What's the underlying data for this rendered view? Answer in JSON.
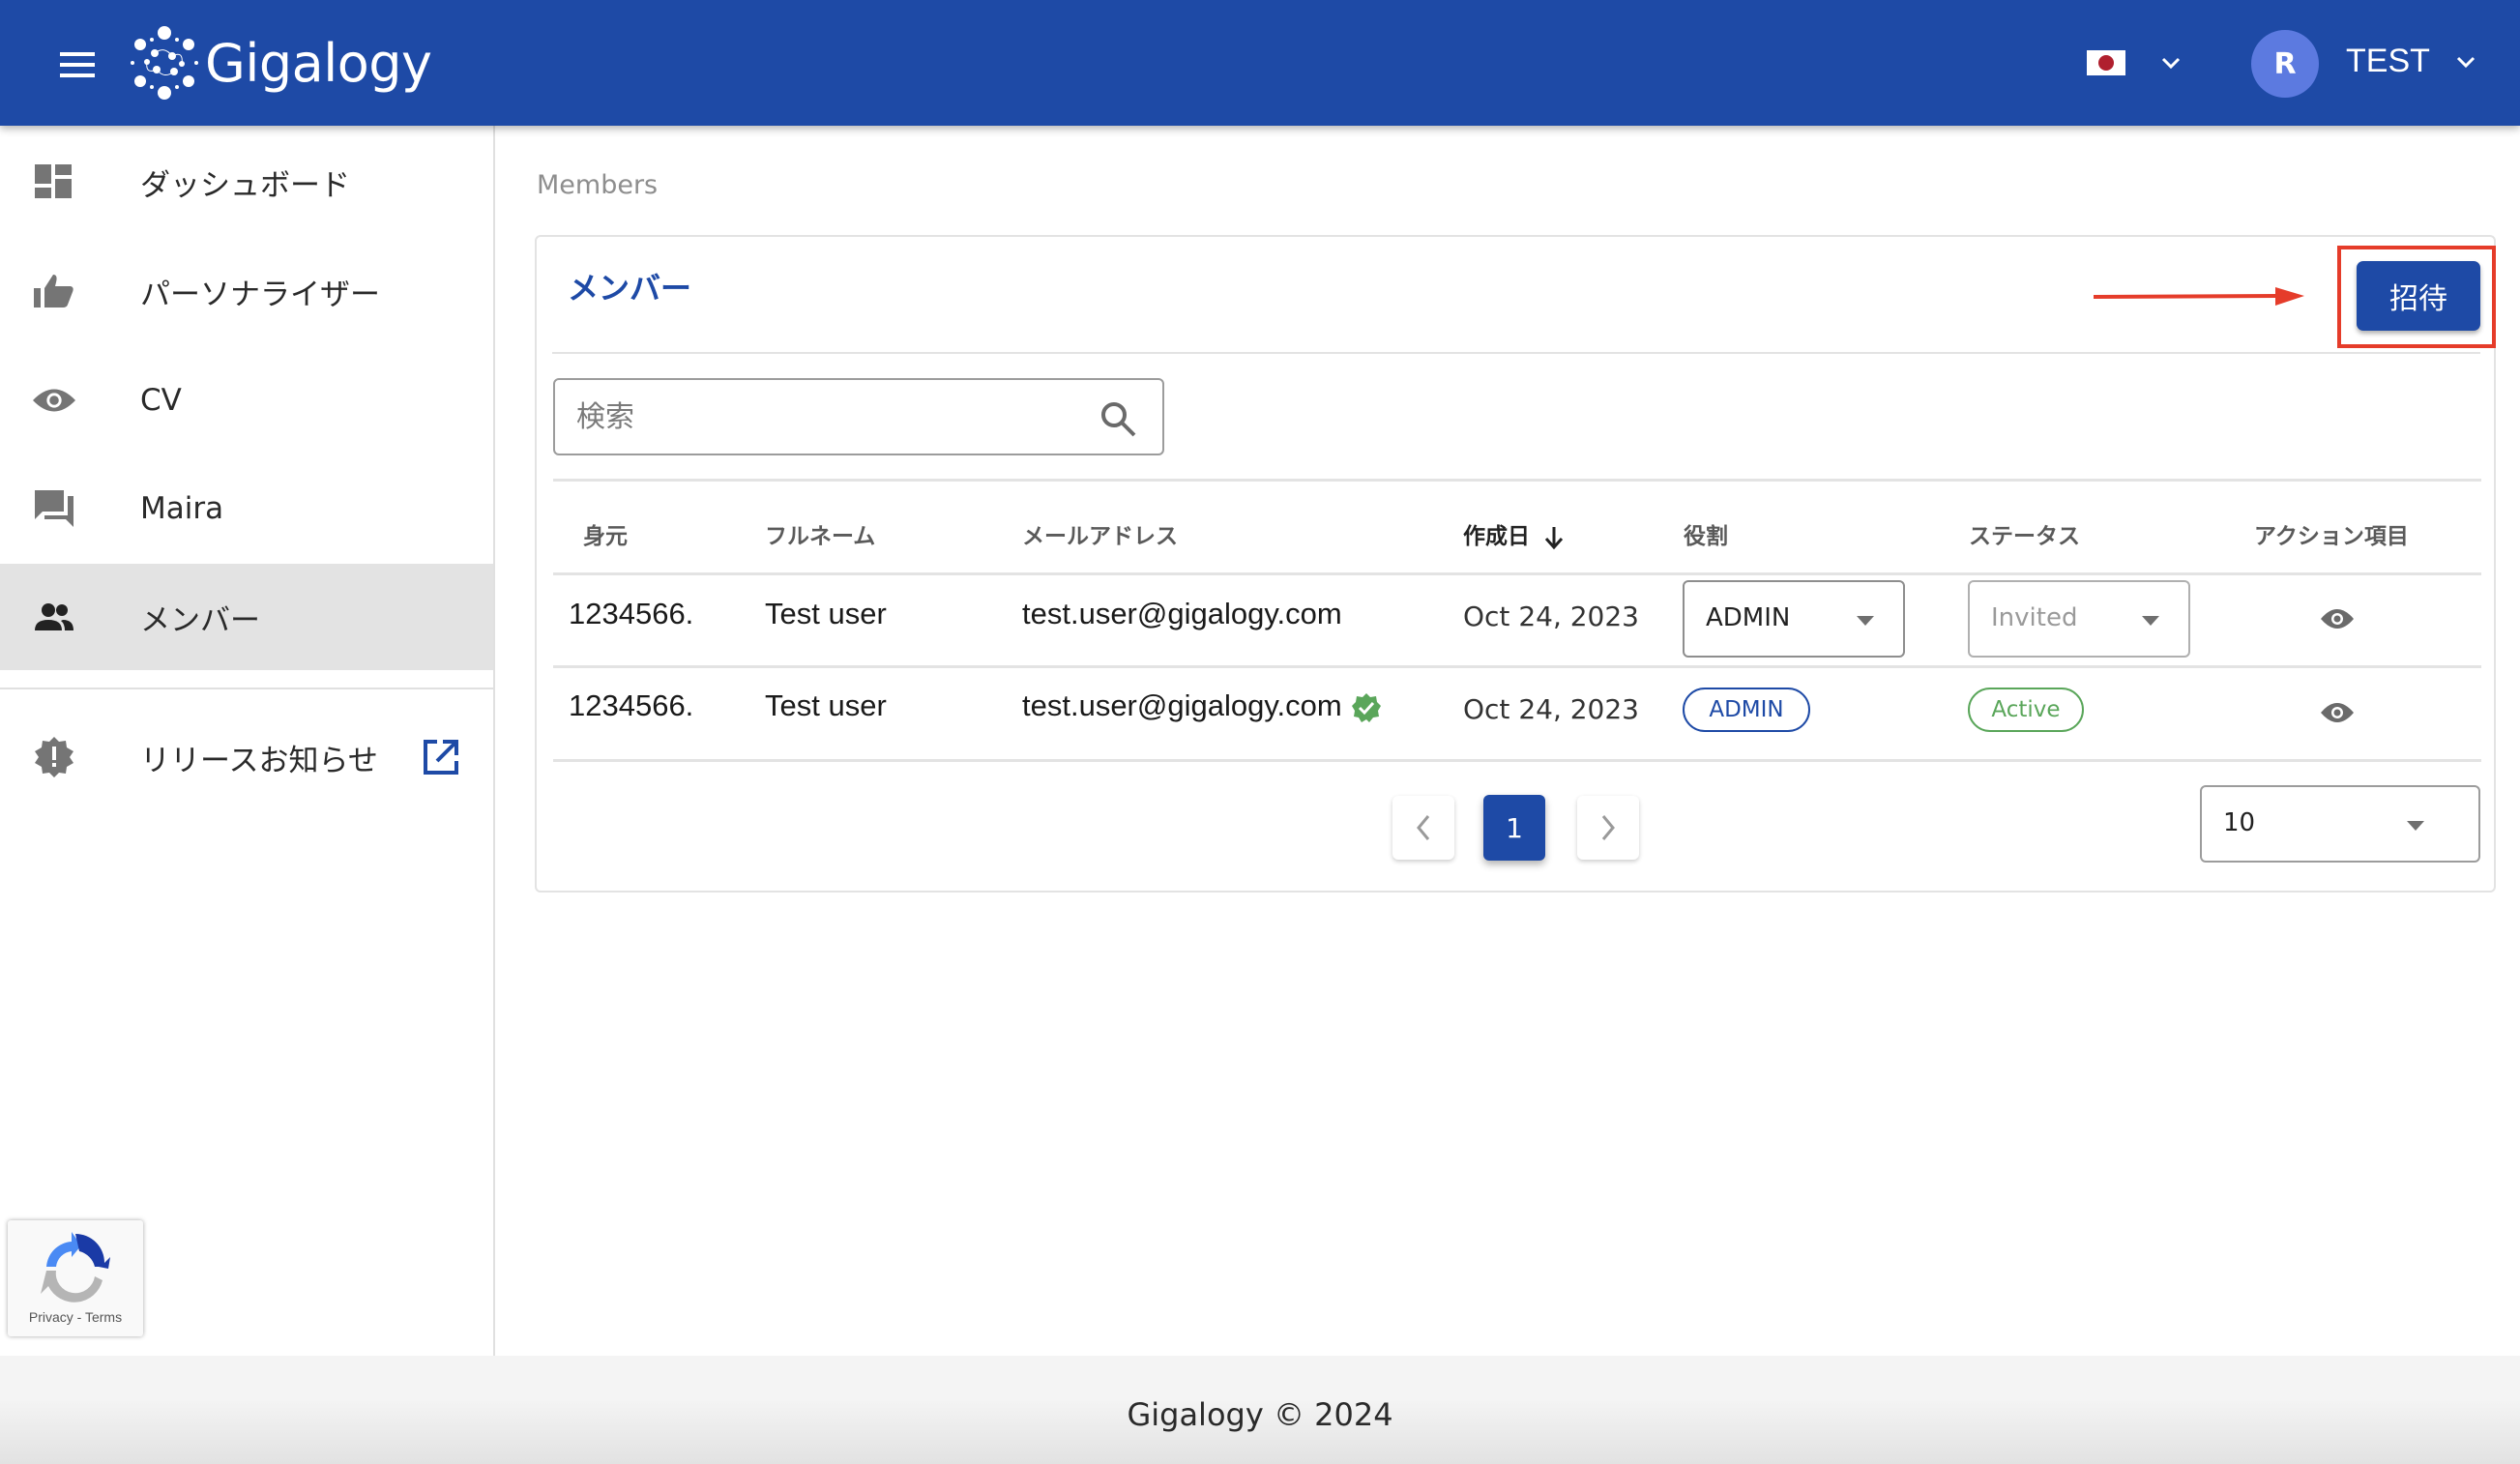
{
  "header": {
    "app_name": "Gigalogy",
    "language_flag": "japan-flag-icon",
    "avatar_initial": "R",
    "user_name": "TEST",
    "brand_color": "#1e4aa6"
  },
  "sidebar": {
    "items": [
      {
        "label": "ダッシュボード",
        "icon": "dashboard-icon",
        "active": false
      },
      {
        "label": "パーソナライザー",
        "icon": "thumb-up-icon",
        "active": false
      },
      {
        "label": "CV",
        "icon": "eye-icon",
        "active": false
      },
      {
        "label": "Maira",
        "icon": "chat-icon",
        "active": false
      },
      {
        "label": "メンバー",
        "icon": "people-icon",
        "active": true
      },
      {
        "label": "リリースお知らせ",
        "icon": "new-release-icon",
        "active": false,
        "external": true
      }
    ],
    "recaptcha_text": "Privacy - Terms"
  },
  "breadcrumb": "Members",
  "card": {
    "title": "メンバー",
    "invite_label": "招待",
    "search_placeholder": "検索"
  },
  "table": {
    "columns": [
      "身元",
      "フルネーム",
      "メールアドレス",
      "作成日",
      "役割",
      "ステータス",
      "アクション項目"
    ],
    "sort_column": "作成日",
    "sort_direction": "desc",
    "rows": [
      {
        "id": "1234566.",
        "name": "Test user",
        "email": "test.user@gigalogy.com",
        "verified": false,
        "created": "Oct 24, 2023",
        "role": "ADMIN",
        "role_editable": true,
        "status": "Invited",
        "status_editable": true
      },
      {
        "id": "1234566.",
        "name": "Test user",
        "email": "test.user@gigalogy.com",
        "verified": true,
        "created": "Oct 24, 2023",
        "role": "ADMIN",
        "role_editable": false,
        "status": "Active",
        "status_editable": false
      }
    ]
  },
  "pagination": {
    "current_page": "1",
    "page_size": "10"
  },
  "colors": {
    "admin_chip": "#1e4aa6",
    "active_chip": "#5aa65a",
    "annotation": "#e53c2a"
  },
  "footer": "Gigalogy © 2024"
}
